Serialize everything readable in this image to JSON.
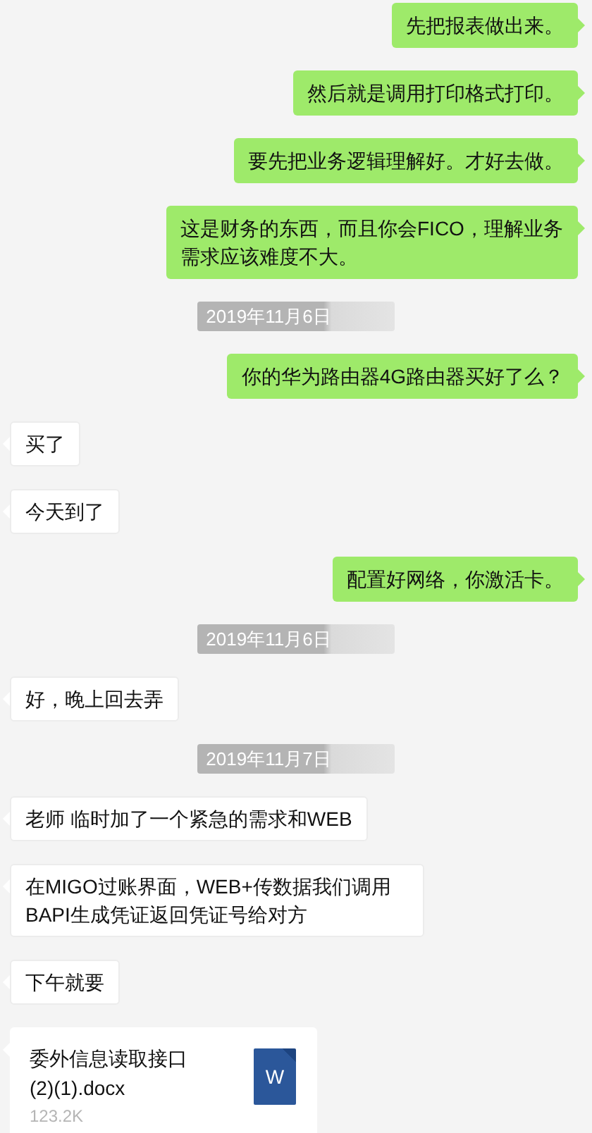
{
  "messages": [
    {
      "kind": "text",
      "outgoing": true,
      "text": "先把报表做出来。"
    },
    {
      "kind": "text",
      "outgoing": true,
      "text": "然后就是调用打印格式打印。"
    },
    {
      "kind": "text",
      "outgoing": true,
      "text": "要先把业务逻辑理解好。才好去做。"
    },
    {
      "kind": "text",
      "outgoing": true,
      "text": "这是财务的东西，而且你会FICO，理解业务需求应该难度不大。"
    },
    {
      "kind": "time",
      "text": "2019年11月6日"
    },
    {
      "kind": "text",
      "outgoing": true,
      "text": "你的华为路由器4G路由器买好了么？"
    },
    {
      "kind": "text",
      "outgoing": false,
      "text": "买了"
    },
    {
      "kind": "text",
      "outgoing": false,
      "text": "今天到了"
    },
    {
      "kind": "text",
      "outgoing": true,
      "text": "配置好网络，你激活卡。"
    },
    {
      "kind": "time",
      "text": "2019年11月6日"
    },
    {
      "kind": "text",
      "outgoing": false,
      "text": "好，晚上回去弄"
    },
    {
      "kind": "time",
      "text": "2019年11月7日"
    },
    {
      "kind": "text",
      "outgoing": false,
      "text": "老师  临时加了一个紧急的需求和WEB"
    },
    {
      "kind": "text",
      "outgoing": false,
      "text": "在MIGO过账界面，WEB+传数据我们调用BAPI生成凭证返回凭证号给对方"
    },
    {
      "kind": "text",
      "outgoing": false,
      "text": "下午就要"
    },
    {
      "kind": "file",
      "outgoing": false,
      "name": "委外信息读取接口(2)(1).docx",
      "size": "123.2K",
      "icon_letter": "W"
    }
  ]
}
